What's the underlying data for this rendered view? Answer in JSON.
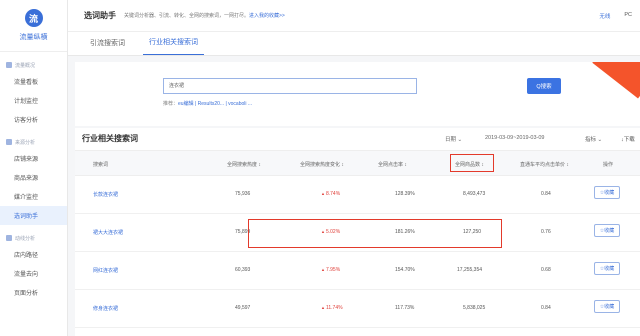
{
  "sidebar": {
    "logo_glyph": "流",
    "brand": "流量纵横",
    "groups": [
      {
        "label": "流量概况",
        "items": [
          "流量看板",
          "计划监控",
          "访客分析"
        ]
      },
      {
        "label": "来源分析",
        "items": [
          "店铺来源",
          "商品来源",
          "媒介监控",
          "选词助手"
        ]
      },
      {
        "label": "动线分析",
        "items": [
          "店内路径",
          "流量去向",
          "页面分析"
        ]
      }
    ],
    "active_item": "选词助手"
  },
  "topbar": {
    "title": "选词助手",
    "desc": "关键词分析器、引流、转化、全网的搜索词，一网打尽。",
    "desc_link": "进入我的收藏>>",
    "right_items": [
      "无线",
      "PC"
    ]
  },
  "tabs": [
    "引流搜索词",
    "行业相关搜索词"
  ],
  "active_tab": "行业相关搜索词",
  "search": {
    "value": "连衣裙",
    "hint_prefix": "推荐：",
    "hint_links": "eu编辑 | Results20... | vocaboli ...",
    "button": "Q搜索"
  },
  "section": {
    "title": "行业相关搜索词",
    "date_label": "日期",
    "date_range": "2019-03-09~2019-03-09",
    "metric_label": "指标",
    "download": "下载"
  },
  "table": {
    "headers": [
      "搜索词",
      "全网搜索热度 ↕",
      "全网搜索热度变化 ↕",
      "全网点击率 ↕",
      "全网商品数 ↕",
      "直通车平均点击单价 ↕",
      "操作"
    ],
    "rows": [
      {
        "kw": "长款连衣裙",
        "heat": "75,936",
        "change": "8.74%",
        "ctr": "128.39%",
        "items": "8,493,473",
        "cpc": "0.84",
        "op": "收藏"
      },
      {
        "kw": "裙大大连衣裙",
        "heat": "75,899",
        "change": "5.02%",
        "ctr": "181.26%",
        "items": "127,250",
        "cpc": "0.76",
        "op": "收藏"
      },
      {
        "kw": "网红连衣裙",
        "heat": "60,393",
        "change": "7.95%",
        "ctr": "154.70%",
        "items": "17,255,354",
        "cpc": "0.68",
        "op": "收藏"
      },
      {
        "kw": "修身连衣裙",
        "heat": "49,597",
        "change": "11.74%",
        "ctr": "117.73%",
        "items": "5,838,025",
        "cpc": "0.84",
        "op": "收藏"
      }
    ]
  },
  "colors": {
    "accent": "#3a6fd8",
    "highlight": "#e33a2b",
    "up": "#e0423c",
    "ribbon": "#f4542b"
  }
}
